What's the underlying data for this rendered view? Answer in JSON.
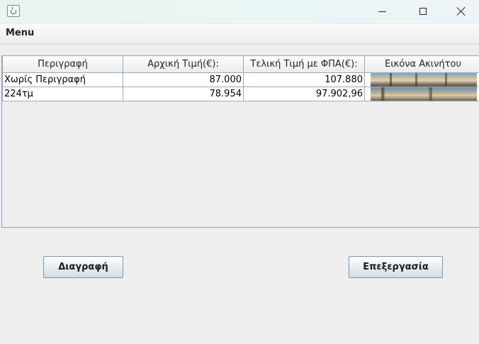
{
  "window": {
    "title": ""
  },
  "menubar": {
    "items": [
      {
        "label": "Menu"
      }
    ]
  },
  "table": {
    "columns": [
      "Περιγραφή",
      "Αρχική Τιμή(€):",
      "Τελική Τιμή με ΦΠΑ(€):",
      "Εικόνα Ακινήτου"
    ],
    "rows": [
      {
        "description": "Χωρίς Περιγραφή",
        "initial_price": "87.000",
        "final_price": "107.880",
        "image": "house-photo"
      },
      {
        "description": "224τμ",
        "initial_price": "78.954",
        "final_price": "97.902,96",
        "image": "house-photo"
      }
    ]
  },
  "buttons": {
    "delete_label": "Διαγραφή",
    "edit_label": "Επεξεργασία"
  },
  "icons": {
    "app": "java-cup-icon",
    "minimize": "minimize-icon",
    "maximize": "maximize-icon",
    "close": "close-icon"
  }
}
